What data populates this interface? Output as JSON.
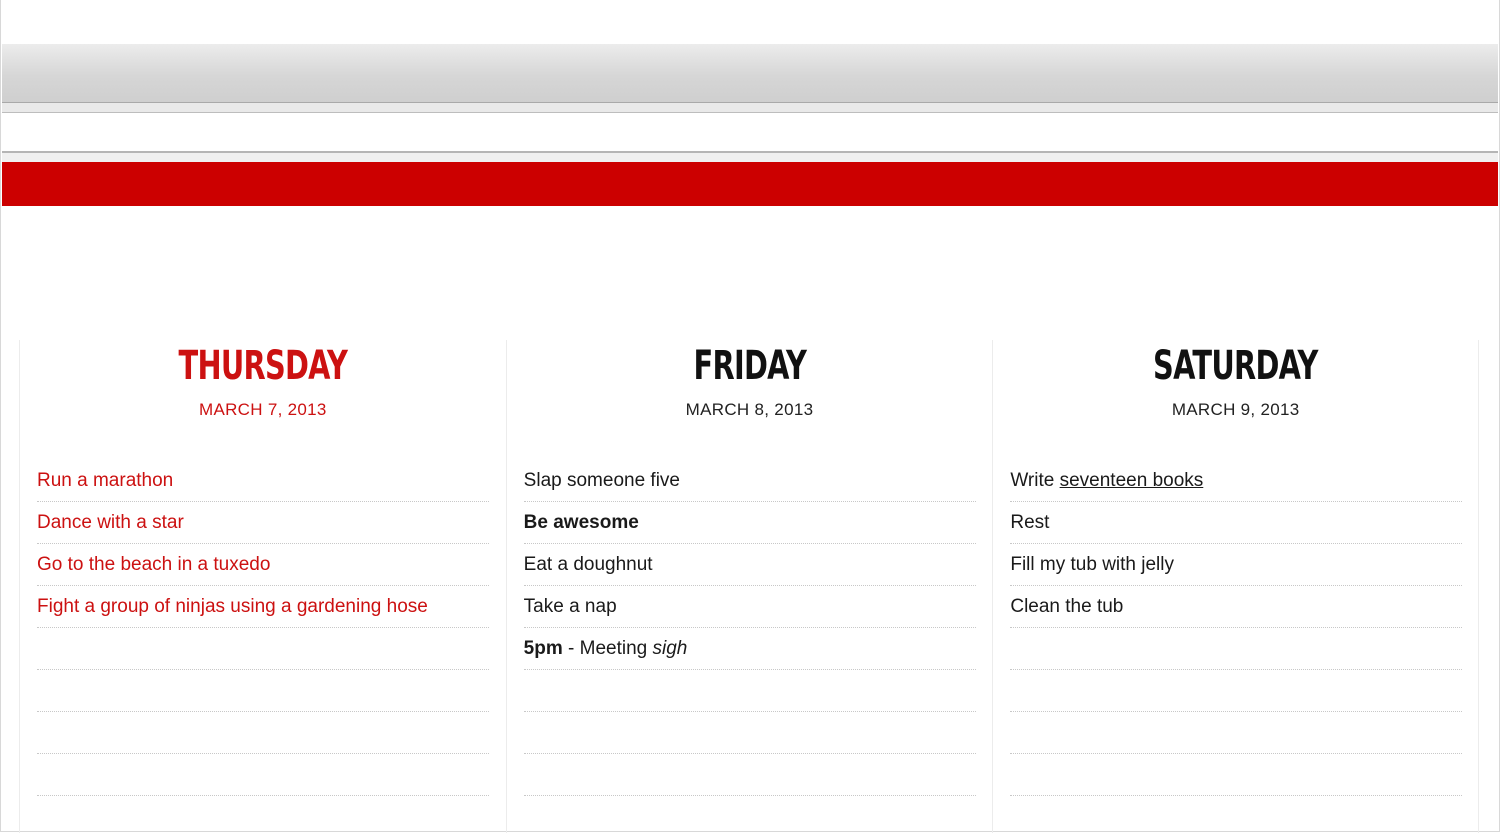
{
  "colors": {
    "accent_red": "#cc0000",
    "text_dark": "#111111"
  },
  "days": [
    {
      "name": "THURSDAY",
      "date": "MARCH 7, 2013",
      "active": true,
      "tasks": [
        "Run a marathon",
        "Dance with a star",
        "Go to the beach in a tuxedo",
        "Fight a group of ninjas using a gardening hose",
        "",
        "",
        "",
        ""
      ]
    },
    {
      "name": "FRIDAY",
      "date": "MARCH 8, 2013",
      "active": false,
      "tasks": [
        "Slap someone five",
        "Be awesome",
        "Eat a doughnut",
        "Take a nap",
        "",
        "",
        "",
        ""
      ],
      "meeting": {
        "time": "5pm",
        "separator": " - Meeting ",
        "note": "sigh"
      }
    },
    {
      "name": "SATURDAY",
      "date": "MARCH 9, 2013",
      "active": false,
      "tasks": [
        "",
        "Rest",
        "Fill my tub with jelly",
        "Clean the tub",
        "",
        "",
        "",
        ""
      ],
      "first_task": {
        "prefix": "Write ",
        "link": "seventeen books"
      }
    }
  ]
}
